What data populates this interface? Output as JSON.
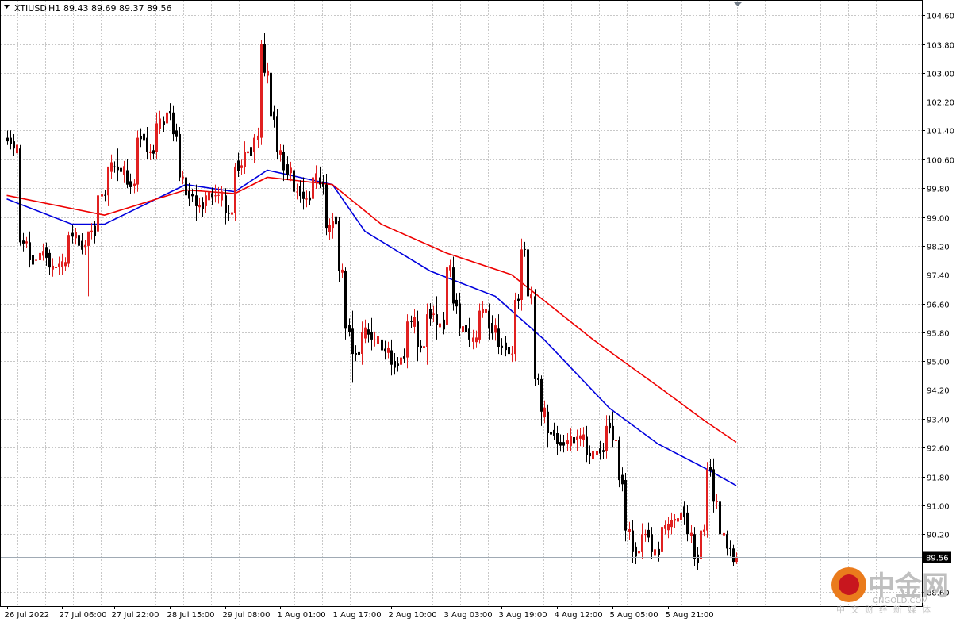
{
  "header": {
    "symbol": "XTIUSD",
    "timeframe": "H1",
    "ohlc": "89.43 89.69 89.37 89.56"
  },
  "watermark": {
    "brand": "中金网",
    "site": "CNGOLD.COM",
    "tagline": "中文财经新媒体"
  },
  "colors": {
    "background": "#ffffff",
    "grid": "#c8c8c8",
    "bull": "#e02020",
    "bear": "#000000",
    "ma_fast": "#0000dd",
    "ma_slow": "#ee0000",
    "price_line": "#a0aab4"
  },
  "chart_data": {
    "type": "candlestick",
    "ylim": [
      88.2,
      105.0
    ],
    "y_ticks": [
      "104.60",
      "103.80",
      "103.00",
      "102.20",
      "101.40",
      "100.60",
      "99.80",
      "99.00",
      "98.20",
      "97.40",
      "96.60",
      "95.80",
      "95.00",
      "94.20",
      "93.40",
      "92.60",
      "91.80",
      "91.00",
      "90.20",
      "88.60"
    ],
    "last_price": "89.56",
    "x_tick_labels": [
      "26 Jul 2022",
      "27 Jul 06:00",
      "27 Jul 22:00",
      "28 Jul 15:00",
      "29 Jul 08:00",
      "1 Aug 01:00",
      "1 Aug 17:00",
      "2 Aug 10:00",
      "3 Aug 03:00",
      "3 Aug 19:00",
      "4 Aug 12:00",
      "5 Aug 05:00",
      "5 Aug 21:00"
    ],
    "x_tick_bar_index": [
      0,
      17,
      33,
      50,
      67,
      84,
      101,
      118,
      135,
      152,
      169,
      186,
      203
    ],
    "anchors": [
      [
        0,
        101.2,
        101.4,
        101.0,
        101.1
      ],
      [
        2,
        101.1,
        101.3,
        100.7,
        100.9
      ],
      [
        4,
        100.9,
        101.0,
        98.2,
        98.3
      ],
      [
        7,
        98.3,
        98.6,
        97.6,
        97.8
      ],
      [
        10,
        97.8,
        98.3,
        97.4,
        98.0
      ],
      [
        13,
        98.0,
        98.1,
        97.4,
        97.6
      ],
      [
        16,
        97.6,
        97.9,
        97.4,
        97.7
      ],
      [
        19,
        97.7,
        98.6,
        97.6,
        98.5
      ],
      [
        22,
        98.5,
        99.2,
        98.0,
        98.2
      ],
      [
        25,
        98.2,
        98.4,
        96.8,
        98.6
      ],
      [
        28,
        98.6,
        99.9,
        98.6,
        99.6
      ],
      [
        31,
        99.6,
        100.3,
        99.3,
        100.4
      ],
      [
        34,
        100.4,
        100.9,
        100.0,
        100.3
      ],
      [
        37,
        100.3,
        100.6,
        99.8,
        99.9
      ],
      [
        40,
        99.9,
        101.4,
        99.7,
        101.2
      ],
      [
        43,
        101.2,
        101.5,
        100.6,
        100.8
      ],
      [
        46,
        100.8,
        101.9,
        100.6,
        101.6
      ],
      [
        49,
        101.6,
        102.3,
        101.3,
        101.9
      ],
      [
        51,
        101.9,
        102.1,
        101.1,
        101.3
      ],
      [
        53,
        101.3,
        101.5,
        100.0,
        100.1
      ],
      [
        55,
        100.1,
        100.6,
        99.0,
        99.6
      ],
      [
        58,
        99.6,
        99.9,
        98.9,
        99.3
      ],
      [
        61,
        99.3,
        99.7,
        99.1,
        99.6
      ],
      [
        64,
        99.6,
        99.9,
        99.4,
        99.6
      ],
      [
        67,
        99.6,
        99.8,
        98.8,
        99.1
      ],
      [
        70,
        99.1,
        100.5,
        98.9,
        100.4
      ],
      [
        73,
        100.4,
        101.1,
        100.2,
        100.8
      ],
      [
        76,
        100.8,
        101.3,
        100.5,
        101.2
      ],
      [
        78,
        101.2,
        103.9,
        101.0,
        103.8
      ],
      [
        79,
        103.8,
        104.1,
        102.9,
        103.0
      ],
      [
        81,
        103.0,
        103.2,
        101.6,
        101.8
      ],
      [
        83,
        101.8,
        102.0,
        100.6,
        100.8
      ],
      [
        85,
        100.8,
        101.0,
        100.0,
        100.3
      ],
      [
        88,
        100.3,
        100.6,
        99.4,
        99.7
      ],
      [
        91,
        99.7,
        100.1,
        99.2,
        99.5
      ],
      [
        94,
        99.5,
        100.1,
        99.3,
        100.1
      ],
      [
        96,
        100.1,
        100.4,
        99.8,
        99.9
      ],
      [
        98,
        99.9,
        100.2,
        98.5,
        98.7
      ],
      [
        100,
        98.7,
        99.1,
        98.4,
        98.9
      ],
      [
        102,
        98.9,
        99.0,
        97.2,
        97.5
      ],
      [
        104,
        97.5,
        97.6,
        95.6,
        95.9
      ],
      [
        106,
        95.9,
        96.4,
        94.4,
        95.2
      ],
      [
        109,
        95.2,
        96.1,
        94.9,
        95.8
      ],
      [
        112,
        95.8,
        96.2,
        95.3,
        95.6
      ],
      [
        115,
        95.6,
        95.9,
        94.8,
        95.3
      ],
      [
        118,
        95.3,
        95.6,
        94.6,
        94.9
      ],
      [
        121,
        94.9,
        95.3,
        94.7,
        95.1
      ],
      [
        123,
        95.1,
        96.3,
        94.8,
        96.1
      ],
      [
        126,
        96.1,
        96.4,
        95.0,
        95.4
      ],
      [
        129,
        95.4,
        96.6,
        94.9,
        96.3
      ],
      [
        132,
        96.3,
        96.8,
        95.6,
        96.0
      ],
      [
        135,
        96.0,
        97.8,
        95.8,
        97.6
      ],
      [
        137,
        97.6,
        97.9,
        96.4,
        96.6
      ],
      [
        139,
        96.6,
        96.9,
        95.7,
        95.9
      ],
      [
        142,
        95.9,
        96.2,
        95.4,
        95.6
      ],
      [
        145,
        95.6,
        96.6,
        95.5,
        96.4
      ],
      [
        148,
        96.4,
        96.6,
        95.6,
        95.9
      ],
      [
        151,
        95.9,
        96.3,
        95.2,
        95.4
      ],
      [
        154,
        95.4,
        95.7,
        94.9,
        95.2
      ],
      [
        156,
        95.2,
        96.9,
        95.0,
        96.7
      ],
      [
        158,
        96.7,
        98.4,
        96.4,
        98.1
      ],
      [
        160,
        98.1,
        98.2,
        96.6,
        96.8
      ],
      [
        162,
        96.8,
        97.0,
        94.3,
        94.5
      ],
      [
        164,
        94.5,
        94.6,
        93.2,
        93.6
      ],
      [
        166,
        93.6,
        93.8,
        92.6,
        93.0
      ],
      [
        169,
        93.0,
        93.2,
        92.4,
        92.7
      ],
      [
        172,
        92.7,
        93.0,
        92.5,
        92.8
      ],
      [
        175,
        92.8,
        93.1,
        92.5,
        92.9
      ],
      [
        178,
        92.9,
        93.2,
        92.2,
        92.4
      ],
      [
        181,
        92.4,
        92.8,
        92.0,
        92.5
      ],
      [
        184,
        92.5,
        93.5,
        92.3,
        93.2
      ],
      [
        186,
        93.2,
        93.6,
        92.6,
        92.8
      ],
      [
        188,
        92.8,
        92.9,
        91.5,
        91.7
      ],
      [
        190,
        91.7,
        91.9,
        90.0,
        90.3
      ],
      [
        192,
        90.3,
        90.6,
        89.4,
        89.7
      ],
      [
        195,
        89.7,
        90.5,
        89.5,
        90.2
      ],
      [
        198,
        90.2,
        90.4,
        89.5,
        89.7
      ],
      [
        201,
        89.7,
        90.6,
        89.6,
        90.4
      ],
      [
        204,
        90.4,
        90.8,
        90.2,
        90.6
      ],
      [
        207,
        90.6,
        91.0,
        90.4,
        90.8
      ],
      [
        209,
        90.8,
        91.0,
        90.0,
        90.2
      ],
      [
        211,
        90.2,
        90.4,
        89.3,
        89.5
      ],
      [
        213,
        89.5,
        90.4,
        88.8,
        90.3
      ],
      [
        215,
        90.3,
        92.2,
        90.1,
        92.0
      ],
      [
        217,
        92.0,
        92.3,
        90.8,
        91.1
      ],
      [
        219,
        91.1,
        91.3,
        90.0,
        90.2
      ],
      [
        221,
        90.2,
        90.3,
        89.6,
        89.8
      ],
      [
        223,
        89.8,
        89.9,
        89.3,
        89.43
      ],
      [
        224,
        89.43,
        89.69,
        89.37,
        89.56
      ]
    ],
    "series": [
      {
        "type": "ma",
        "values_at": [
          [
            0,
            99.5
          ],
          [
            20,
            98.8
          ],
          [
            30,
            98.8
          ],
          [
            55,
            99.9
          ],
          [
            70,
            99.7
          ],
          [
            80,
            100.3
          ],
          [
            100,
            99.9
          ],
          [
            110,
            98.6
          ],
          [
            130,
            97.5
          ],
          [
            150,
            96.8
          ],
          [
            165,
            95.6
          ],
          [
            185,
            93.7
          ],
          [
            200,
            92.7
          ],
          [
            215,
            92.0
          ],
          [
            224,
            91.55
          ]
        ]
      },
      {
        "type": "ma",
        "values_at": [
          [
            0,
            99.6
          ],
          [
            30,
            99.05
          ],
          [
            55,
            99.75
          ],
          [
            70,
            99.65
          ],
          [
            80,
            100.1
          ],
          [
            100,
            99.9
          ],
          [
            115,
            98.8
          ],
          [
            135,
            98.0
          ],
          [
            155,
            97.4
          ],
          [
            180,
            95.6
          ],
          [
            200,
            94.3
          ],
          [
            215,
            93.3
          ],
          [
            224,
            92.75
          ]
        ]
      }
    ]
  }
}
